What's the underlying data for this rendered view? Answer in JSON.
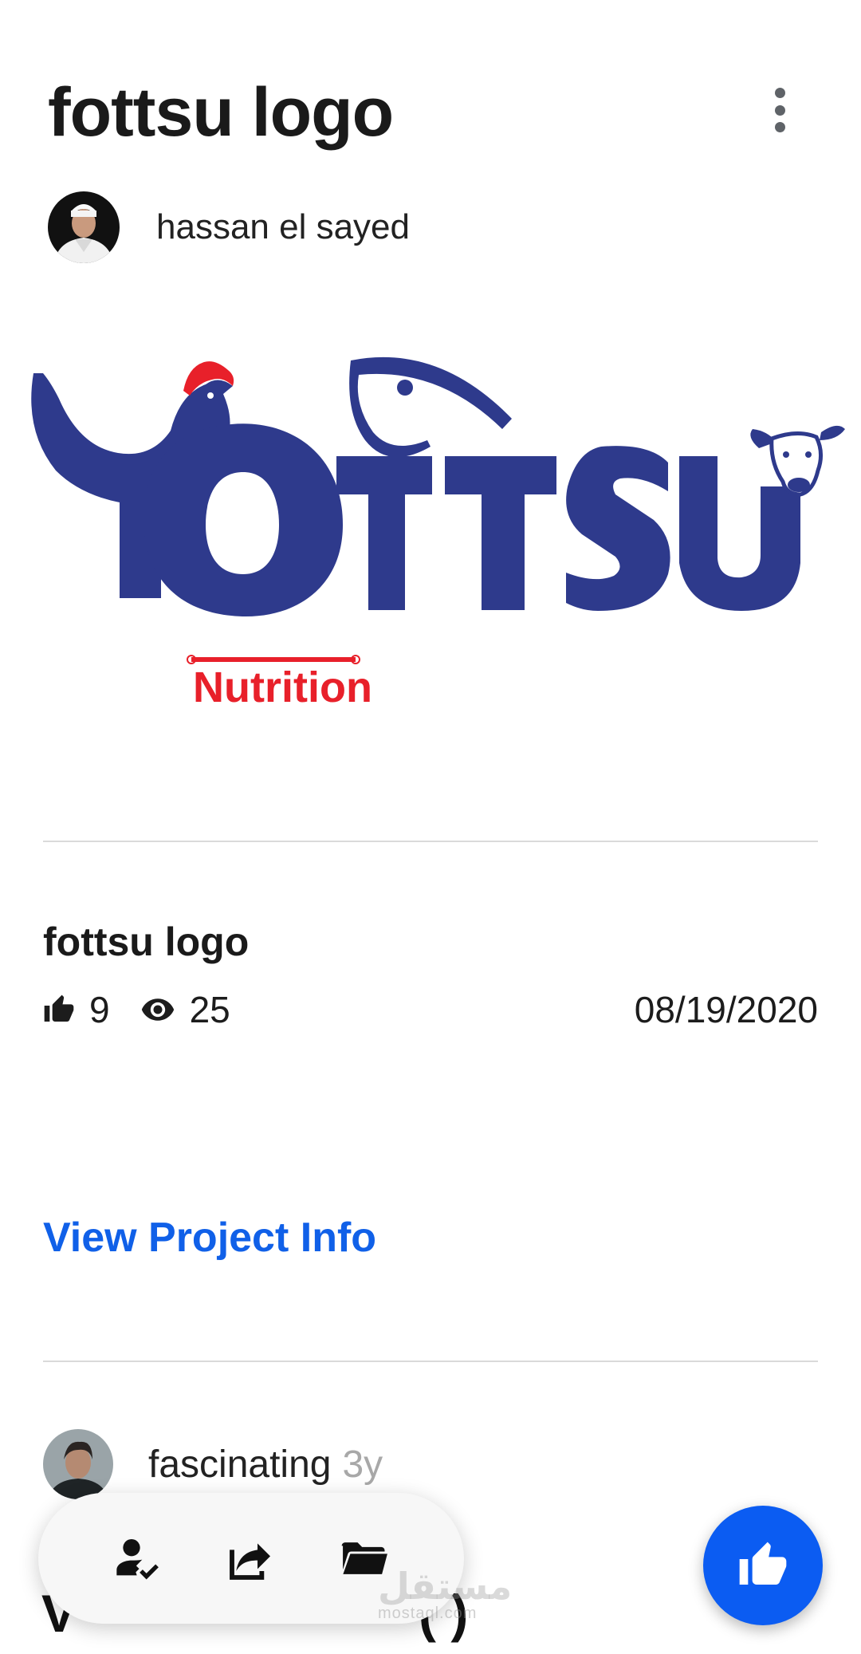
{
  "header": {
    "title": "fottsu logo",
    "more_icon": "more-vertical-icon"
  },
  "author": {
    "name": "hassan el sayed"
  },
  "cover": {
    "brand_text": "FOTTSU",
    "tagline": "Nutrition",
    "brand_color": "#2e3a8c",
    "accent_color": "#e8202a"
  },
  "project": {
    "title": "fottsu logo",
    "likes": "9",
    "views": "25",
    "date": "08/19/2020"
  },
  "view_project_info_label": "View Project Info",
  "comment": {
    "text": "fascinating",
    "time": "3y"
  },
  "next_section": {
    "leading": "V",
    "trailing": "( )"
  },
  "bottom_bar": {
    "icons": [
      "follow-user-icon",
      "share-icon",
      "folder-icon"
    ]
  },
  "watermark": {
    "text": "مستقل",
    "sub": "mostaql.com"
  },
  "colors": {
    "link": "#1060e8",
    "fab": "#0b5cf2"
  }
}
